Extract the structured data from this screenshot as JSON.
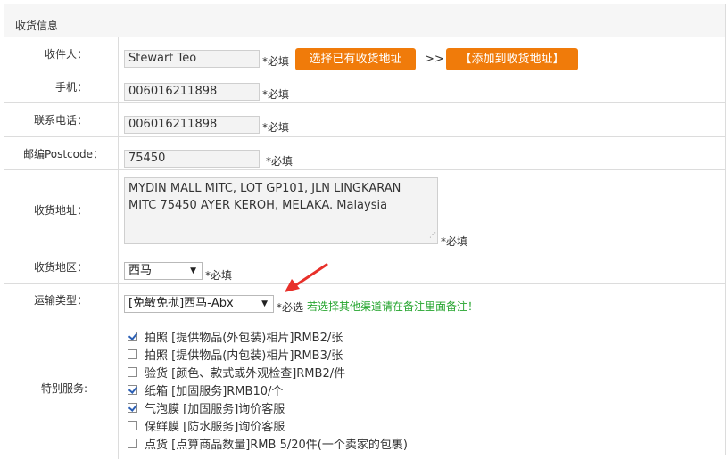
{
  "section": {
    "title": "收货信息"
  },
  "recipient": {
    "label": "收件人：",
    "value": "Stewart Teo",
    "required": "*必填",
    "select_button": "选择已有收货地址",
    "arrows": ">>",
    "add_button": "【添加到收货地址】"
  },
  "mobile": {
    "label": "手机：",
    "value": "006016211898",
    "required": "*必填"
  },
  "phone": {
    "label": "联系电话：",
    "value": "006016211898",
    "required": "*必填"
  },
  "postcode": {
    "label": "邮编Postcode：",
    "value": "75450",
    "required": "*必填"
  },
  "address": {
    "label": "收货地址：",
    "line1": "MYDIN MALL MITC, LOT GP101, JLN LINGKARAN",
    "line2": "MITC 75450 AYER KEROH, MELAKA. Malaysia",
    "required": "*必填"
  },
  "region": {
    "label": "收货地区：",
    "selected": "西马",
    "required": "*必填"
  },
  "shipping": {
    "label": "运输类型：",
    "selected": "[免敏免抛]西马-Abx",
    "required": "*必选",
    "hint": "若选择其他渠道请在备注里面备注！"
  },
  "services": {
    "label": "特别服务:",
    "items": [
      {
        "label": "拍照 [提供物品(外包装)相片]RMB2/张",
        "checked": true
      },
      {
        "label": "拍照 [提供物品(内包装)相片]RMB3/张",
        "checked": false
      },
      {
        "label": "验货 [颜色、款式或外观检查]RMB2/件",
        "checked": false
      },
      {
        "label": "纸箱 [加固服务]RMB10/个",
        "checked": true
      },
      {
        "label": "气泡膜 [加固服务]询价客服",
        "checked": true
      },
      {
        "label": "保鲜膜 [防水服务]询价客服",
        "checked": false
      },
      {
        "label": "点货 [点算商品数量]RMB 5/20件(一个卖家的包裹)",
        "checked": false
      }
    ]
  },
  "colors": {
    "accent": "#f07b0a",
    "hint": "#26a52f",
    "annotation_arrow": "#e8302a"
  }
}
